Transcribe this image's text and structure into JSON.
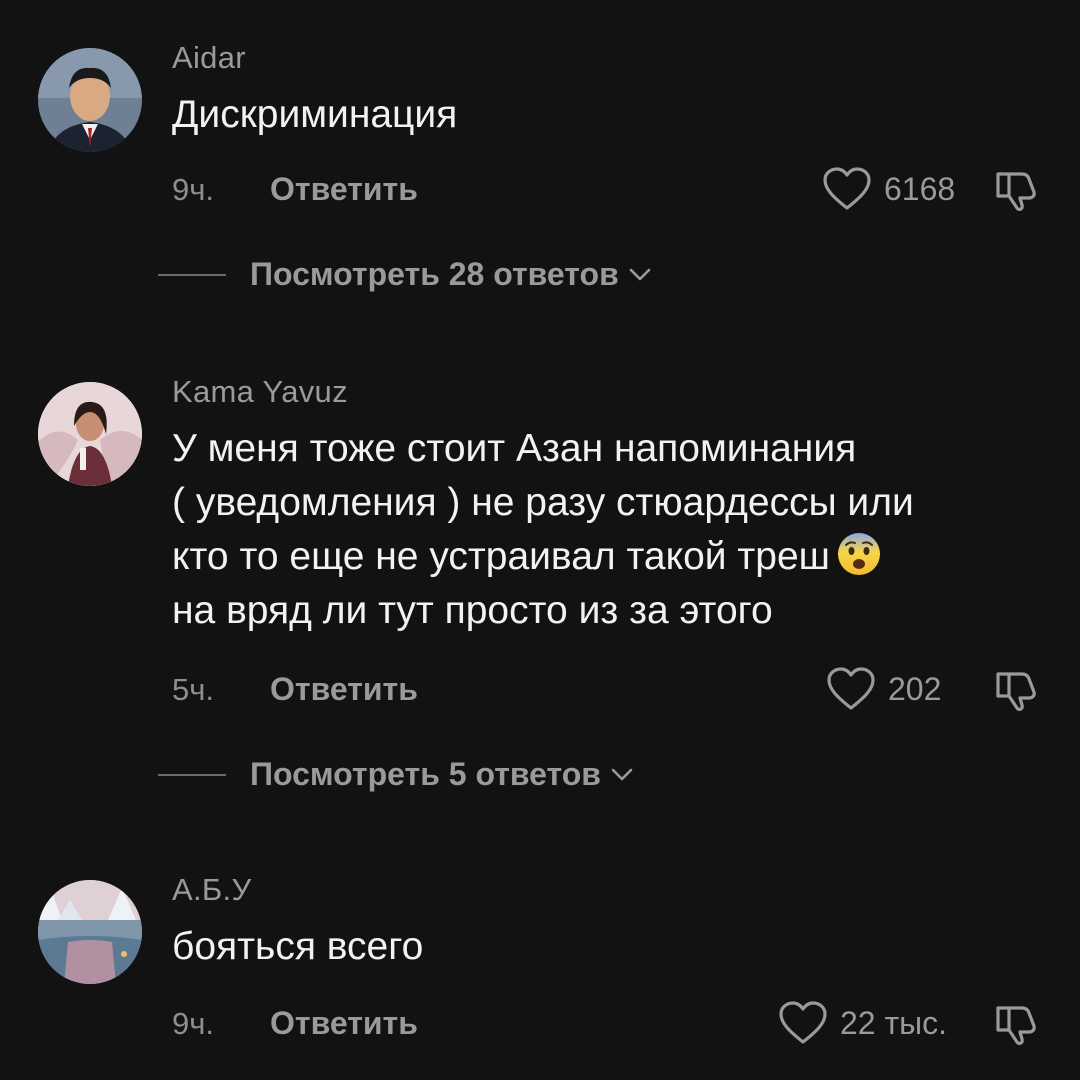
{
  "comments": [
    {
      "username": "Aidar",
      "text": "Дискриминация",
      "time": "9ч.",
      "reply_label": "Ответить",
      "likes": "6168",
      "replies_label": "Посмотреть 28 ответов"
    },
    {
      "username": "Kama Yavuz",
      "text_lines": [
        "У меня тоже стоит Азан напоминания",
        "( уведомления ) не разу стюардессы или",
        "кто то еще не устраивал такой треш",
        "на вряд ли тут просто из за этого"
      ],
      "emoji": "fearful-face-emoji",
      "time": "5ч.",
      "reply_label": "Ответить",
      "likes": "202",
      "replies_label": "Посмотреть 5 ответов"
    },
    {
      "username": "А.Б.У",
      "text": "бояться всего",
      "time": "9ч.",
      "reply_label": "Ответить",
      "likes": "22 тыс."
    }
  ],
  "icons": {
    "like": "heart-outline-icon",
    "dislike": "thumbs-down-outline-icon",
    "expand": "chevron-down-icon"
  },
  "colors": {
    "background": "#121212",
    "primary_text": "#f2f2f2",
    "secondary_text": "#9a9a9a"
  }
}
